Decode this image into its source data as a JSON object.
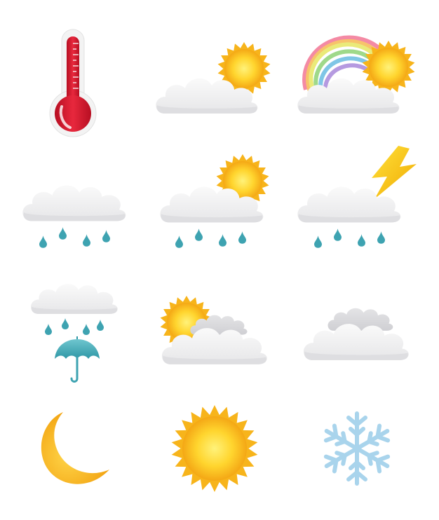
{
  "icons": [
    {
      "name": "thermometer-icon"
    },
    {
      "name": "sun-behind-cloud-icon"
    },
    {
      "name": "rainbow-sun-cloud-icon"
    },
    {
      "name": "rain-cloud-icon"
    },
    {
      "name": "sun-cloud-rain-icon"
    },
    {
      "name": "thunderstorm-cloud-icon"
    },
    {
      "name": "rain-umbrella-icon"
    },
    {
      "name": "partly-cloudy-icon"
    },
    {
      "name": "overcast-clouds-icon"
    },
    {
      "name": "crescent-moon-icon"
    },
    {
      "name": "sun-icon"
    },
    {
      "name": "snowflake-icon"
    }
  ],
  "colors": {
    "background": "#ffffff",
    "cloud_light": "#f2f2f2",
    "cloud_shadow": "#d9d9dc",
    "sun_outer": "#f7b41b",
    "sun_inner": "#ffe04a",
    "thermometer_red": "#d9162c",
    "raindrop": "#3ea3b1",
    "umbrella": "#45aab6",
    "lightning": "#f5c400",
    "moon": "#f8b821",
    "snowflake": "#a9d4ec"
  }
}
